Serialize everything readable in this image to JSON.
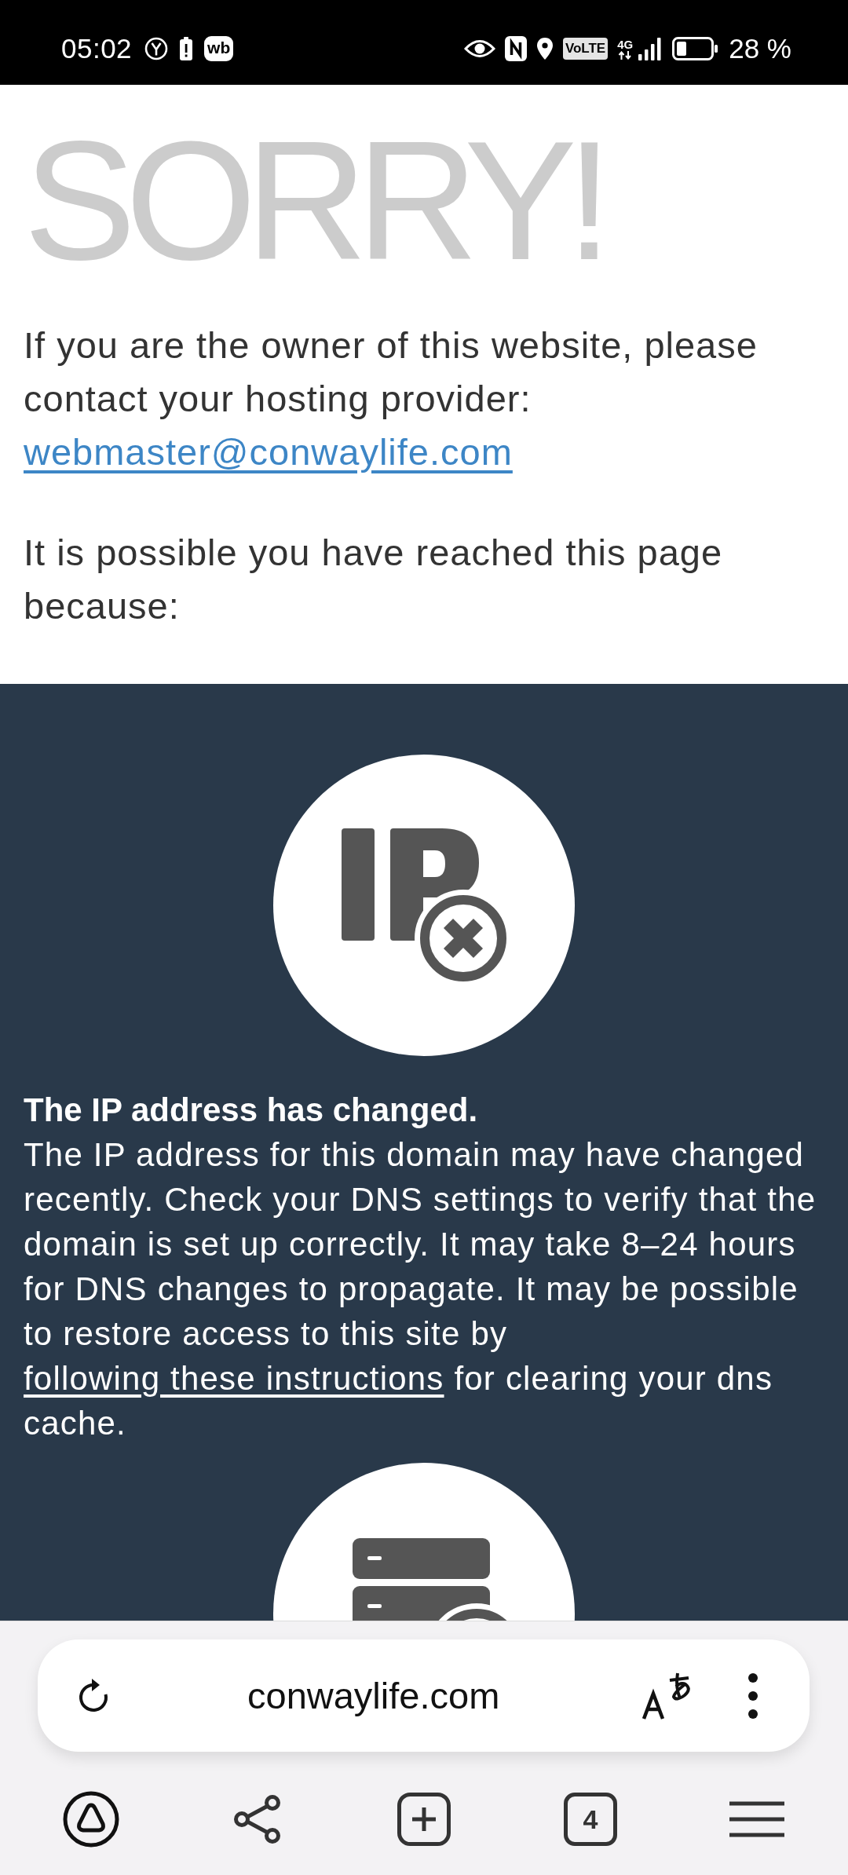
{
  "status_bar": {
    "time": "05:02",
    "app_badge": "wb",
    "volte_label": "VoLTE",
    "network_label": "4G",
    "battery_text": "28 %"
  },
  "page": {
    "title": "SORRY!",
    "owner_notice": "If you are the owner of this website, please contact your hosting provider:",
    "contact_email": "webmaster@conwaylife.com",
    "reasons_intro": "It is possible you have reached this page because:"
  },
  "reasons": [
    {
      "kind": "ip-changed",
      "heading": "The IP address has changed.",
      "text": "The IP address for this domain may have changed recently. Check your DNS settings to verify that the domain is set up correctly. It may take 8–24 hours for DNS changes to propagate. It may be possible to restore access to this site by",
      "link": "following these instructions",
      "text_after": "for clearing your dns cache."
    },
    {
      "kind": "server-error"
    }
  ],
  "browser": {
    "url": "conwaylife.com",
    "tab_count": "4"
  }
}
